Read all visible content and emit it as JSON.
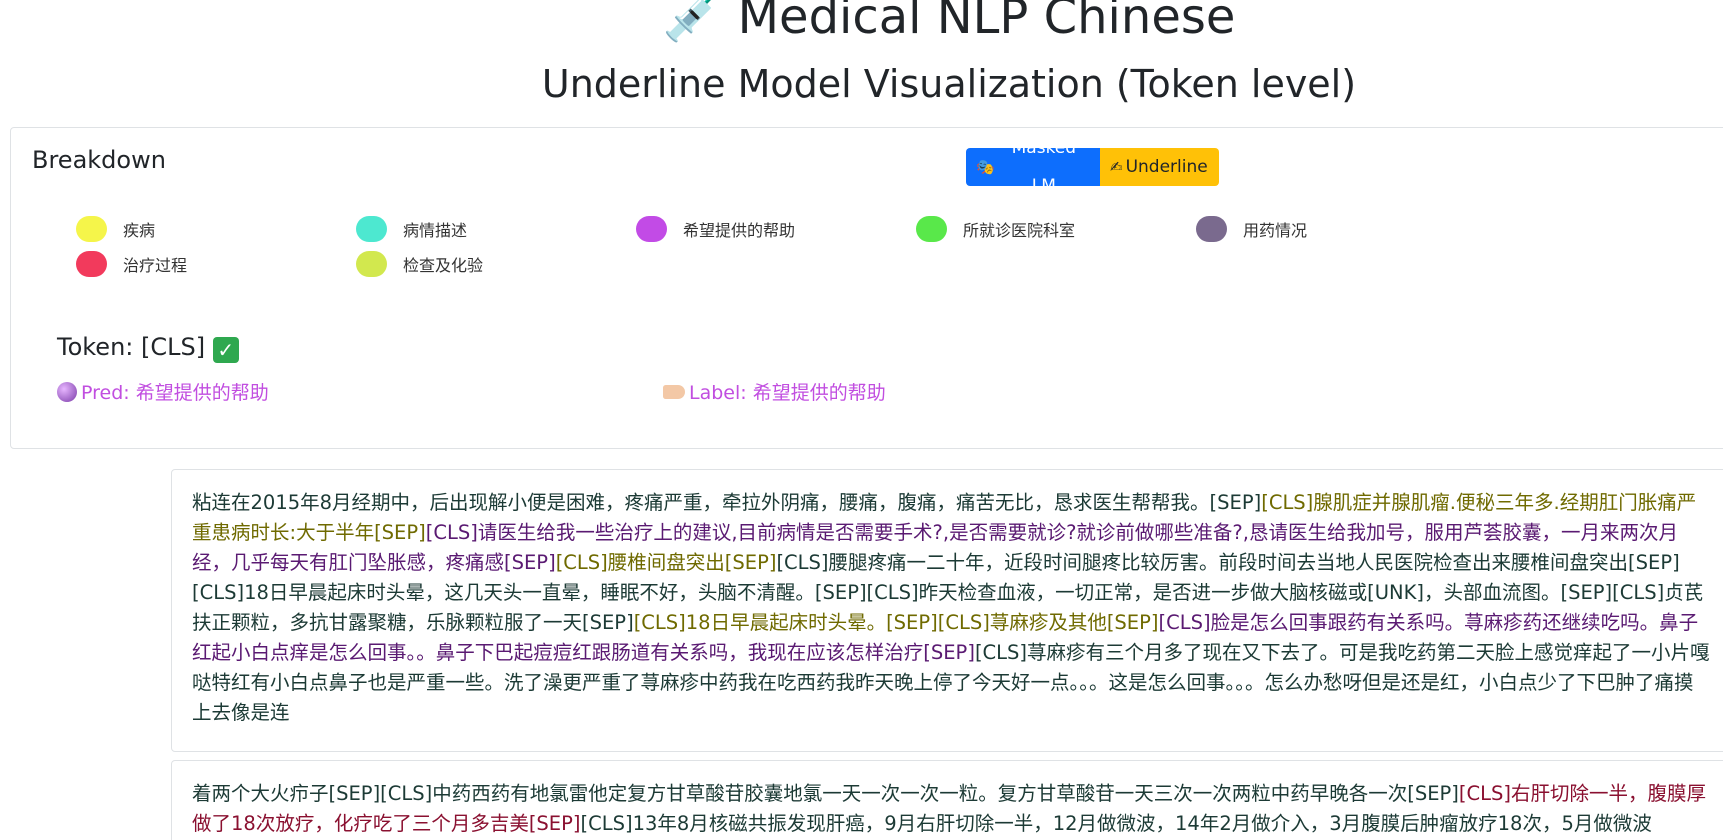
{
  "header": {
    "title": "💉 Medical NLP Chinese",
    "subtitle": "Underline Model Visualization (Token level)"
  },
  "breakdown": {
    "title": "Breakdown",
    "buttons": {
      "masked_lm": "Masked LM",
      "underline": "Underline"
    },
    "legend": [
      {
        "label": "疾病",
        "color": "#f5f54a"
      },
      {
        "label": "病情描述",
        "color": "#4de8d0"
      },
      {
        "label": "希望提供的帮助",
        "color": "#c24be6"
      },
      {
        "label": "所就诊医院科室",
        "color": "#59e84a"
      },
      {
        "label": "用药情况",
        "color": "#7a6a8e"
      },
      {
        "label": "治疗过程",
        "color": "#f23a5c"
      },
      {
        "label": "检查及化验",
        "color": "#d2e84e"
      }
    ],
    "token": "Token: [CLS] ",
    "token_check": "✓",
    "pred": "Pred: 希望提供的帮助",
    "label": "Label: 希望提供的帮助"
  },
  "texts": [
    {
      "segments": [
        {
          "c": "dark",
          "t": "粘连在2015年8月经期中，后出现解小便是困难，疼痛严重，牵拉外阴痛，腰痛，腹痛，痛苦无比，恳求医生帮帮我。[SEP]"
        },
        {
          "c": "olive",
          "t": "[CLS]腺肌症并腺肌瘤.便秘三年多.经期肛门胀痛严重患病时长:大于半年[SEP]"
        },
        {
          "c": "purple",
          "t": "[CLS]请医生给我一些治疗上的建议,目前病情是否需要手术?,是否需要就诊?就诊前做哪些准备?,恳请医生给我加号，服用芦荟胶囊，一月来两次月经，几乎每天有肛门坠胀感，疼痛感[SEP]"
        },
        {
          "c": "olive",
          "t": "[CLS]腰椎间盘突出[SEP]"
        },
        {
          "c": "dark",
          "t": "[CLS]腰腿疼痛一二十年，近段时间腿疼比较厉害。前段时间去当地人民医院检查出来腰椎间盘突出[SEP][CLS]18日早晨起床时头晕，这几天头一直晕，睡眠不好，头脑不清醒。[SEP][CLS]昨天检查血液，一切正常，是否进一步做大脑核磁或[UNK]，头部血流图。[SEP][CLS]贞芪扶正颗粒，多抗甘露聚糖，乐脉颗粒服了一天[SEP]"
        },
        {
          "c": "olive",
          "t": "[CLS]18日早晨起床时头晕。[SEP][CLS]荨麻疹及其他[SEP]"
        },
        {
          "c": "purple",
          "t": "[CLS]脸是怎么回事跟药有关系吗。荨麻疹药还继续吃吗。鼻子红起小白点痒是怎么回事。。鼻子下巴起痘痘红跟肠道有关系吗，我现在应该怎样治疗[SEP]"
        },
        {
          "c": "dark",
          "t": "[CLS]荨麻疹有三个月多了现在又下去了。可是我吃药第二天脸上感觉痒起了一小片嘎哒特红有小白点鼻子也是严重一些。洗了澡更严重了荨麻疹中药我在吃西药我昨天晚上停了今天好一点。。。这是怎么回事。。。怎么办愁呀但是还是红，小白点少了下巴肿了痛摸上去像是连"
        }
      ]
    },
    {
      "segments": [
        {
          "c": "dark",
          "t": "着两个大火疖子[SEP][CLS]中药西药有地氯雷他定复方甘草酸苷胶囊地氯一天一次一次一粒。复方甘草酸苷一天三次一次两粒中药早晚各一次[SEP]"
        },
        {
          "c": "red",
          "t": "[CLS]右肝切除一半，腹膜厚做了18次放疗，化疗吃了三个月多吉美[SEP]"
        },
        {
          "c": "dark",
          "t": "[CLS]13年8月核磁共振发现肝癌，9月右肝切除一半，12月做微波，14年2月做介入，3月腹膜后肿瘤放疗18次，5月做微波"
        }
      ]
    }
  ]
}
